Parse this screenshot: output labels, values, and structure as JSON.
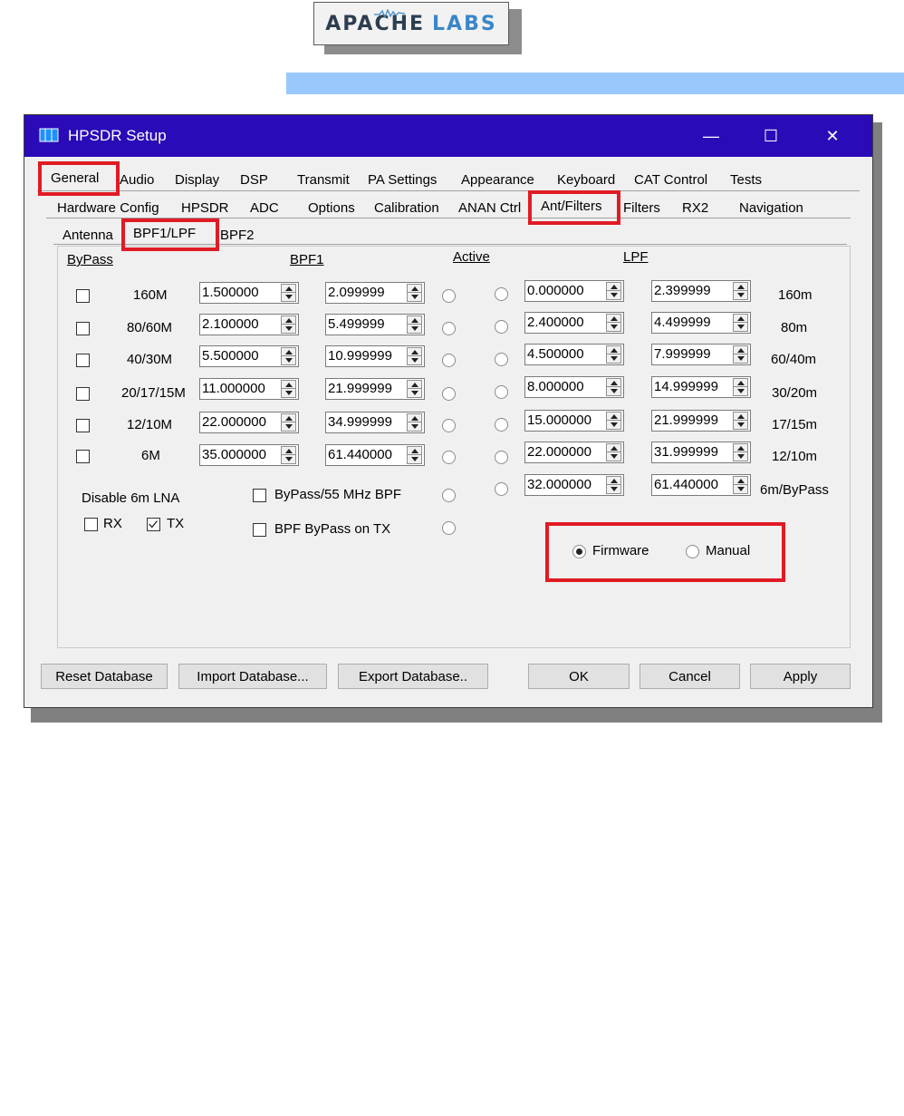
{
  "logo": {
    "text_a": "APACHE",
    "text_b": "LABS"
  },
  "colors": {
    "titlebar": "#2b0bb8",
    "highlight": "#e01b24",
    "banner": "#99c8ff"
  },
  "window": {
    "title": "HPSDR Setup",
    "minimize": "—",
    "maximize": "☐",
    "close": "✕"
  },
  "tabs_main": [
    "General",
    "Audio",
    "Display",
    "DSP",
    "Transmit",
    "PA Settings",
    "Appearance",
    "Keyboard",
    "CAT Control",
    "Tests"
  ],
  "tabs_general": [
    "Hardware Config",
    "HPSDR",
    "ADC",
    "Options",
    "Calibration",
    "ANAN Ctrl",
    "Ant/Filters",
    "Filters",
    "RX2",
    "Navigation"
  ],
  "tabs_antfilters": [
    "Antenna",
    "BPF1/LPF",
    "BPF2"
  ],
  "headers": {
    "bypass": "ByPass",
    "bpf1": "BPF1",
    "active": "Active",
    "lpf": "LPF"
  },
  "bpf_rows": [
    {
      "label": "160M",
      "low": "1.500000",
      "high": "2.099999"
    },
    {
      "label": "80/60M",
      "low": "2.100000",
      "high": "5.499999"
    },
    {
      "label": "40/30M",
      "low": "5.500000",
      "high": "10.999999"
    },
    {
      "label": "20/17/15M",
      "low": "11.000000",
      "high": "21.999999"
    },
    {
      "label": "12/10M",
      "low": "22.000000",
      "high": "34.999999"
    },
    {
      "label": "6M",
      "low": "35.000000",
      "high": "61.440000"
    }
  ],
  "lpf_rows": [
    {
      "label": "160m",
      "low": "0.000000",
      "high": "2.399999"
    },
    {
      "label": "80m",
      "low": "2.400000",
      "high": "4.499999"
    },
    {
      "label": "60/40m",
      "low": "4.500000",
      "high": "7.999999"
    },
    {
      "label": "30/20m",
      "low": "8.000000",
      "high": "14.999999"
    },
    {
      "label": "17/15m",
      "low": "15.000000",
      "high": "21.999999"
    },
    {
      "label": "12/10m",
      "low": "22.000000",
      "high": "31.999999"
    },
    {
      "label": "6m/ByPass",
      "low": "32.000000",
      "high": "61.440000"
    }
  ],
  "lna": {
    "title": "Disable 6m LNA",
    "rx": "RX",
    "tx": "TX"
  },
  "options": {
    "bypass55": "ByPass/55 MHz BPF",
    "bpf_bypass_tx": "BPF ByPass on TX"
  },
  "mode": {
    "firmware": "Firmware",
    "manual": "Manual"
  },
  "buttons": {
    "reset": "Reset Database",
    "import": "Import Database...",
    "export": "Export Database..",
    "ok": "OK",
    "cancel": "Cancel",
    "apply": "Apply"
  }
}
